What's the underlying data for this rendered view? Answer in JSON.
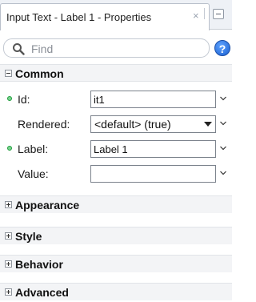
{
  "panel": {
    "title": "Input Text - Label 1 - Properties",
    "close_glyph": "×"
  },
  "search": {
    "placeholder": "Find",
    "value": ""
  },
  "help": {
    "glyph": "?"
  },
  "sections": {
    "common": {
      "title": "Common",
      "properties": {
        "id": {
          "label": "Id:",
          "value": "it1",
          "required": true
        },
        "rendered": {
          "label": "Rendered:",
          "value": "<default> (true)",
          "required": false
        },
        "label": {
          "label": "Label:",
          "value": "Label 1",
          "required": true
        },
        "value": {
          "label": "Value:",
          "value": "",
          "required": false
        }
      }
    },
    "appearance": {
      "title": "Appearance"
    },
    "style": {
      "title": "Style"
    },
    "behavior": {
      "title": "Behavior"
    },
    "advanced": {
      "title": "Advanced"
    }
  },
  "icons": {
    "search": "search-icon",
    "help": "help-icon",
    "required": "required-dot-icon",
    "chevron": "chevron-down-icon",
    "collapse": "minus-box-icon",
    "expand": "plus-box-icon"
  },
  "colors": {
    "required_dot": "#7ad38f",
    "help_blue": "#1a5fd0",
    "section_bg": "#f3f4f6"
  }
}
